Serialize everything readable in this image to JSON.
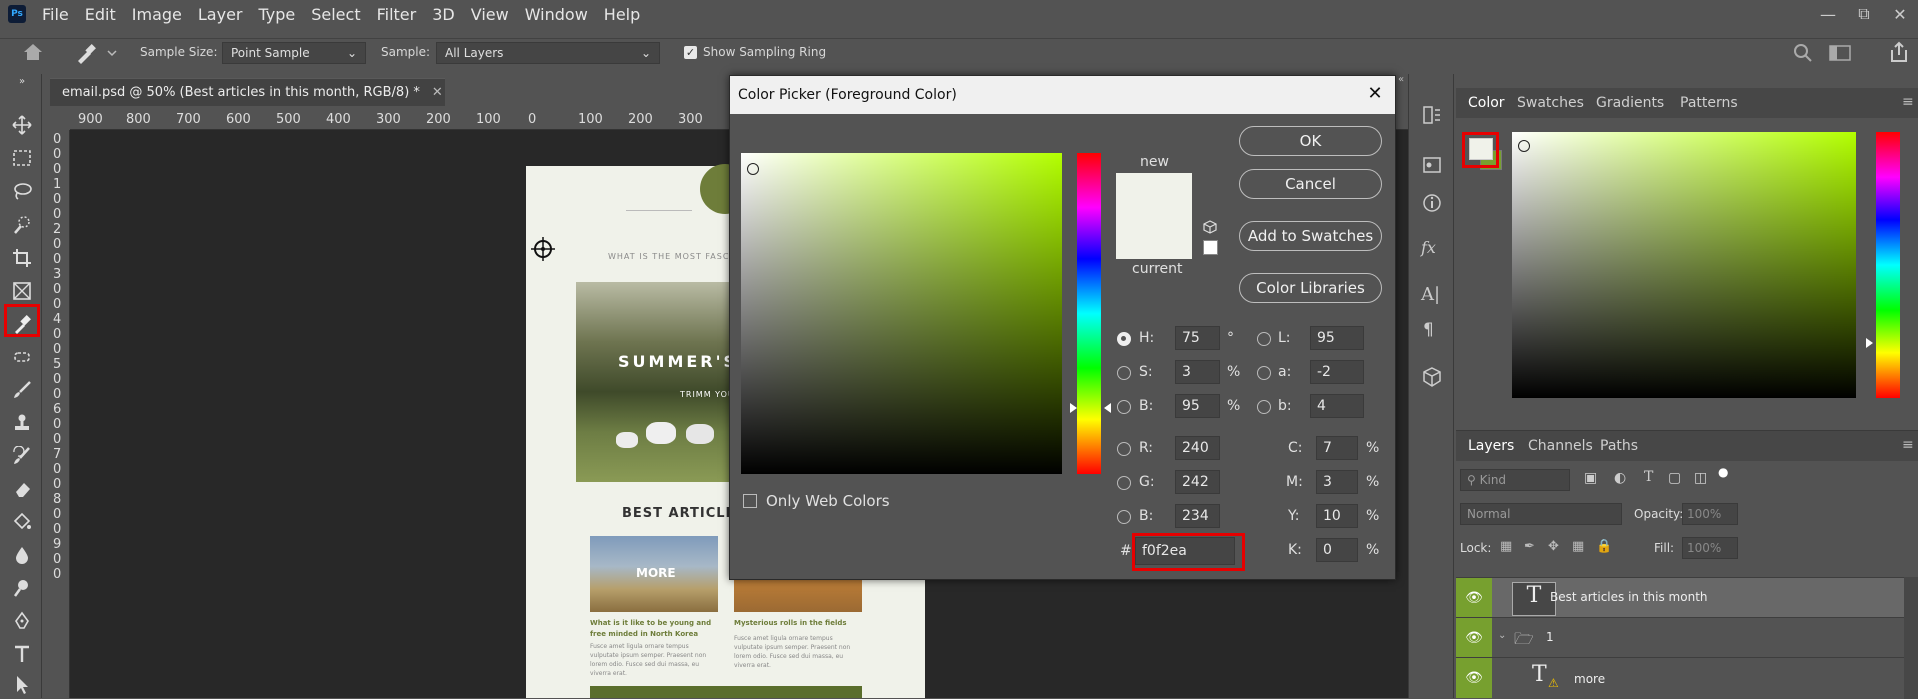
{
  "app": {
    "logo": "Ps",
    "menu": [
      "File",
      "Edit",
      "Image",
      "Layer",
      "Type",
      "Select",
      "Filter",
      "3D",
      "View",
      "Window",
      "Help"
    ]
  },
  "options_bar": {
    "sample_size_label": "Sample Size:",
    "sample_size_value": "Point Sample",
    "sample_label": "Sample:",
    "sample_value": "All Layers",
    "show_sampling_ring_label": "Show Sampling Ring",
    "show_sampling_ring_checked": true
  },
  "document": {
    "tab_title": "email.psd @ 50% (Best articles in this month, RGB/8) *",
    "ruler_h_ticks": [
      "900",
      "800",
      "700",
      "600",
      "500",
      "400",
      "300",
      "200",
      "100",
      "0",
      "100",
      "200",
      "300"
    ],
    "ruler_v_digits": [
      "0",
      "0",
      "0",
      "1",
      "0",
      "0",
      "2",
      "0",
      "0",
      "3",
      "0",
      "0",
      "4",
      "0",
      "0",
      "5",
      "0",
      "0",
      "6",
      "0",
      "0",
      "7",
      "0",
      "0",
      "8",
      "0",
      "0",
      "9",
      "0",
      "0"
    ],
    "page": {
      "header_text": "WHAT IS THE MOST FASCINAT",
      "hero_text": "SUMMER'S",
      "hero_sub": "TRIMM YOU",
      "section_title": "BEST ARTICLES",
      "more_label": "MORE",
      "article1_title": "What is it like to be young and free minded in North Korea",
      "article1_body": "Fusce amet ligula ornare tempus vulputate ipsum semper. Praesent non lorem odio. Fusce sed dui massa, eu viverra erat.",
      "article2_title": "Mysterious rolls in the fields",
      "article2_body": "Fusce amet ligula ornare tempus vulputate ipsum semper. Praesent non lorem odio. Fusce sed dui massa, eu viverra erat."
    }
  },
  "color_picker": {
    "title": "Color Picker (Foreground Color)",
    "new_label": "new",
    "current_label": "current",
    "new_color": "#f0f2ea",
    "current_color": "#f0f2ea",
    "buttons": {
      "ok": "OK",
      "cancel": "Cancel",
      "add_to_swatches": "Add to Swatches",
      "color_libraries": "Color Libraries"
    },
    "only_web_colors_label": "Only Web Colors",
    "hsb": {
      "h_label": "H:",
      "h_value": "75",
      "h_unit": "°",
      "s_label": "S:",
      "s_value": "3",
      "s_unit": "%",
      "b_label": "B:",
      "b_value": "95",
      "b_unit": "%"
    },
    "rgb": {
      "r_label": "R:",
      "r_value": "240",
      "g_label": "G:",
      "g_value": "242",
      "b_label": "B:",
      "b_value": "234"
    },
    "lab": {
      "l_label": "L:",
      "l_value": "95",
      "a_label": "a:",
      "a_value": "-2",
      "b_label": "b:",
      "b_value": "4"
    },
    "cmyk": {
      "c_label": "C:",
      "c_value": "7",
      "m_label": "M:",
      "m_value": "3",
      "y_label": "Y:",
      "y_value": "10",
      "k_label": "K:",
      "k_value": "0",
      "unit": "%"
    },
    "hex_label": "#",
    "hex_value": "f0f2ea",
    "hue_color": "#b3ff00"
  },
  "color_panel": {
    "tabs": [
      "Color",
      "Swatches",
      "Gradients",
      "Patterns"
    ],
    "foreground": "#f0f2ea",
    "background": "#77a02f"
  },
  "layers_panel": {
    "tabs": [
      "Layers",
      "Channels",
      "Paths"
    ],
    "kind_placeholder": "Kind",
    "blend_mode": "Normal",
    "opacity_label": "Opacity:",
    "opacity_value": "100%",
    "lock_label": "Lock:",
    "fill_label": "Fill:",
    "fill_value": "100%",
    "layers": [
      {
        "name": "Best articles in this month",
        "type": "text"
      },
      {
        "name": "1",
        "type": "group"
      },
      {
        "name": "more",
        "type": "text"
      }
    ]
  },
  "accent_colors": {
    "highlight_red": "#e60000",
    "layer_eye_green": "#77a02f"
  }
}
